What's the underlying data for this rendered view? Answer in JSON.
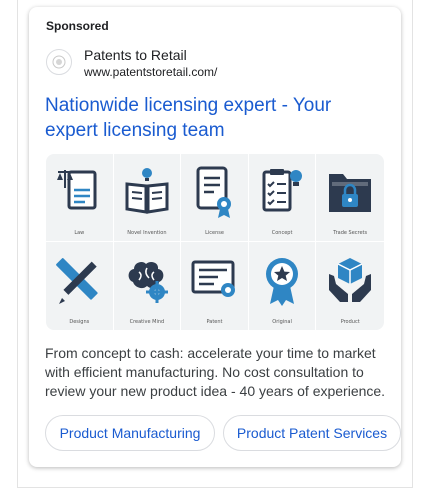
{
  "ad": {
    "sponsored_label": "Sponsored",
    "advertiser_name": "Patents to Retail",
    "display_url": "www.patentstoretail.com/",
    "headline": "Nationwide licensing expert - Your expert licensing team",
    "description": "From concept to cash: accelerate your time to market with efficient manufacturing. No cost consultation to review your new product idea - 40 years of experience.",
    "sitelinks": [
      "Product Manufacturing",
      "Product Patent Services"
    ]
  },
  "image_grid": {
    "tiles": [
      {
        "label": "Law",
        "icon": "scales-document-icon"
      },
      {
        "label": "Novel Invention",
        "icon": "open-book-icon"
      },
      {
        "label": "License",
        "icon": "license-certificate-icon"
      },
      {
        "label": "Concept",
        "icon": "checklist-lightbulb-icon"
      },
      {
        "label": "Trade Secrets",
        "icon": "folder-lock-icon"
      },
      {
        "label": "Designs",
        "icon": "ruler-pencil-icon"
      },
      {
        "label": "Creative Mind",
        "icon": "brain-gear-icon"
      },
      {
        "label": "Patent",
        "icon": "patent-certificate-icon"
      },
      {
        "label": "Original",
        "icon": "star-badge-icon"
      },
      {
        "label": "Product",
        "icon": "hands-box-icon"
      }
    ]
  },
  "colors": {
    "link": "#1a5bd0",
    "icon_dark": "#2d3a4f",
    "icon_accent": "#2f86c4"
  }
}
